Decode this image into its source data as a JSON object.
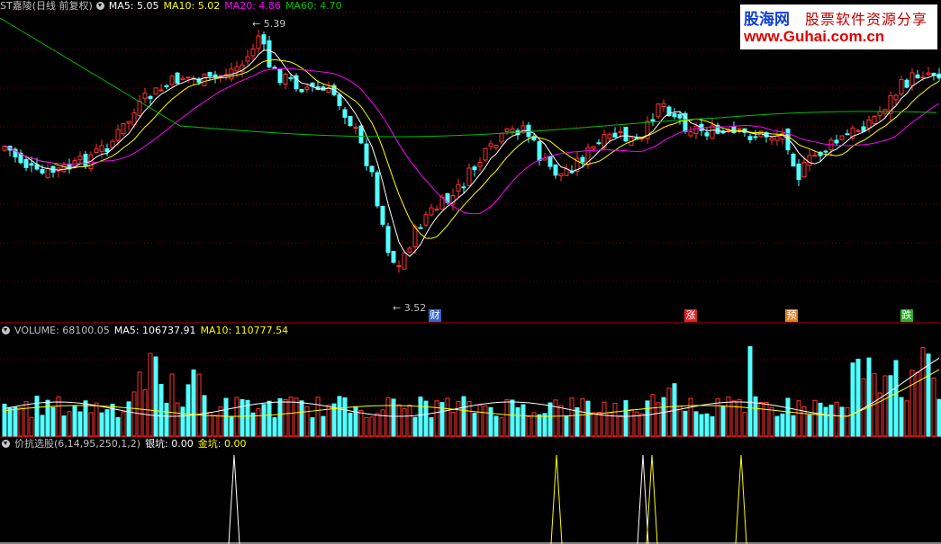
{
  "price_panel": {
    "stock_name": "ST嘉陵(日线 前复权)",
    "ma5": "MA5: 5.05",
    "ma10": "MA10: 5.02",
    "ma20": "MA20: 4.86",
    "ma60": "MA60: 4.70",
    "high_label": "5.39",
    "low_label": "3.52",
    "markers": [
      "财",
      "涨",
      "预",
      "跌"
    ],
    "colors": {
      "ma5": "#ffffff",
      "ma10": "#ffff00",
      "ma20": "#ff00ff",
      "ma60": "#00c000",
      "up": "#ff3232",
      "down": "#54ffff"
    }
  },
  "volume_panel": {
    "volume": "VOLUME: 68100.05",
    "ma5": "MA5: 106737.91",
    "ma10": "MA10: 110777.54"
  },
  "indicator_panel": {
    "name": "价抗选股(6,14,95,250,1,2)",
    "yinkang": "银坑: 0.00",
    "jinkang": "金坑: 0.00"
  },
  "watermark": {
    "site": "股海网",
    "slogan": "股票软件资源分享",
    "url": "www.Guhai.com.cn"
  },
  "chart_data": {
    "type": "candlestick",
    "high": 5.39,
    "low": 3.52,
    "ma_last": {
      "ma5": 5.05,
      "ma10": 5.02,
      "ma20": 4.86,
      "ma60": 4.7
    },
    "volume_last": 68100.05,
    "volume_ma_last": {
      "ma5": 106737.91,
      "ma10": 110777.54
    },
    "indicator_last": {
      "银坑": 0.0,
      "金坑": 0.0
    }
  }
}
